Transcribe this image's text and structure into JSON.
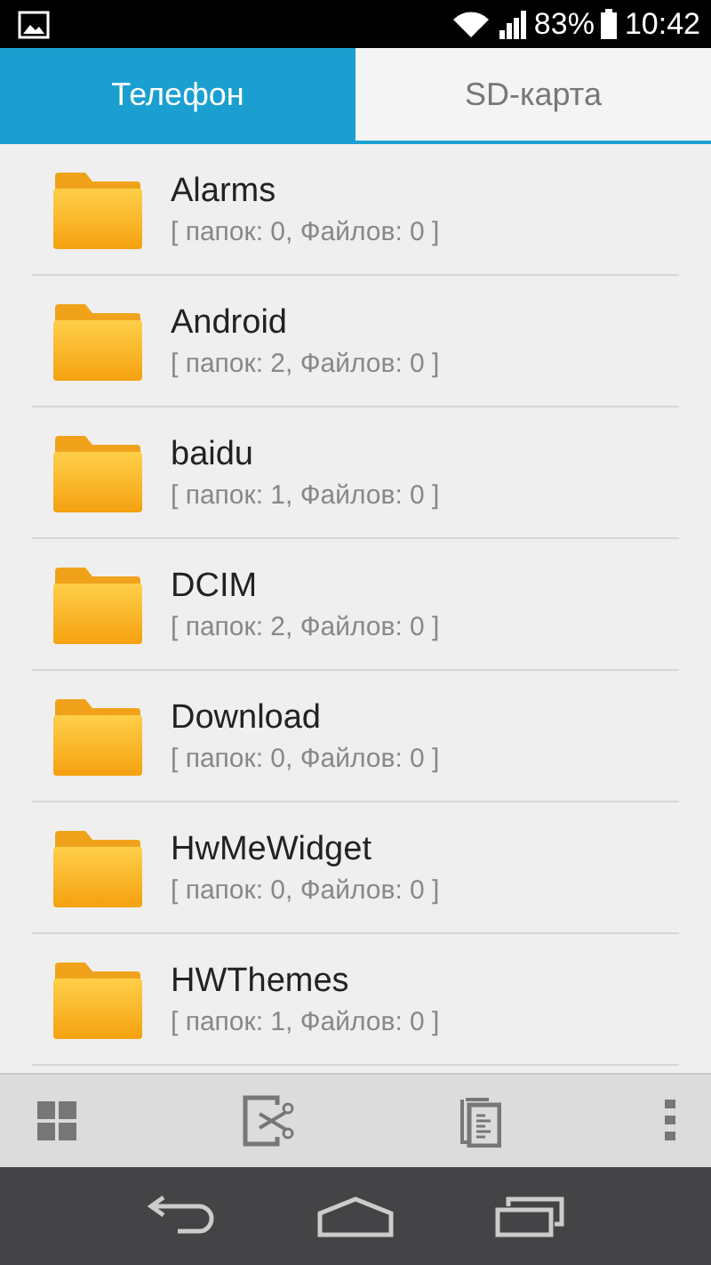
{
  "status_bar": {
    "battery": "83%",
    "time": "10:42"
  },
  "tabs": [
    {
      "label": "Телефон",
      "selected": true
    },
    {
      "label": "SD-карта",
      "selected": false
    }
  ],
  "folders": [
    {
      "name": "Alarms",
      "info": "[ папок: 0, Файлов: 0 ]"
    },
    {
      "name": "Android",
      "info": "[ папок: 2, Файлов: 0 ]"
    },
    {
      "name": "baidu",
      "info": "[ папок: 1, Файлов: 0 ]"
    },
    {
      "name": "DCIM",
      "info": "[ папок: 2, Файлов: 0 ]"
    },
    {
      "name": "Download",
      "info": "[ папок: 0, Файлов: 0 ]"
    },
    {
      "name": "HwMeWidget",
      "info": "[ папок: 0, Файлов: 0 ]"
    },
    {
      "name": "HWThemes",
      "info": "[ папок: 1, Файлов: 0 ]"
    }
  ]
}
